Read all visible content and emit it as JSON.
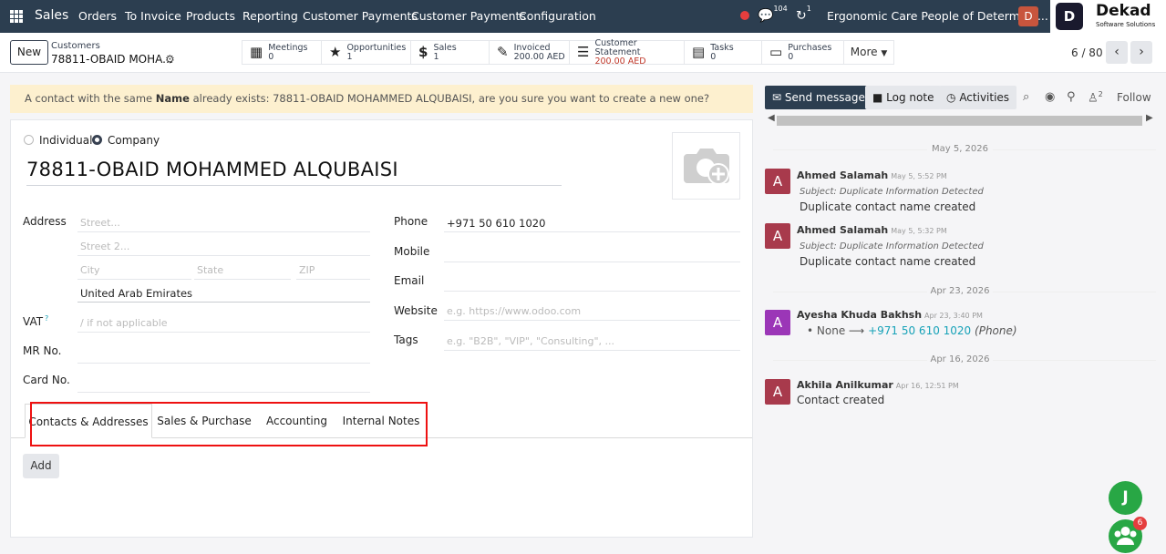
{
  "topbar": {
    "app_name": "Sales",
    "menu": [
      "Orders",
      "To Invoice",
      "Products",
      "Reporting",
      "Customer Payments",
      "Customer Payments",
      "Configuration"
    ],
    "messages_count": "104",
    "activities_count": "1",
    "company": "Ergonomic Care People of Determina...",
    "user_initial": "D",
    "brand_name": "Dekad",
    "brand_sub": "Software Solutions",
    "brand_logo": "D"
  },
  "control_panel": {
    "new_label": "New",
    "breadcrumb_parent": "Customers",
    "breadcrumb_current": "78811-OBAID MOHA...",
    "smart_buttons": [
      {
        "icon": "calendar-icon",
        "label": "Meetings",
        "value": "0"
      },
      {
        "icon": "star-icon",
        "label": "Opportunities",
        "value": "1"
      },
      {
        "icon": "dollar-icon",
        "label": "Sales",
        "value": "1"
      },
      {
        "icon": "invoice-icon",
        "label": "Invoiced",
        "value": "200.00 AED"
      },
      {
        "icon": "list-icon",
        "label": "Customer Statement",
        "value": "200.00 AED"
      },
      {
        "icon": "tasks-icon",
        "label": "Tasks",
        "value": "0"
      },
      {
        "icon": "credit-card-icon",
        "label": "Purchases",
        "value": "0"
      }
    ],
    "more_label": "More",
    "pager": "6 / 80"
  },
  "warning": {
    "prefix": "A contact with the same ",
    "bold": "Name",
    "suffix": " already exists: 78811-OBAID MOHAMMED ALQUBAISI, are you sure you want to create a new one?"
  },
  "form": {
    "type_individual": "Individual",
    "type_company": "Company",
    "name": "78811-OBAID MOHAMMED ALQUBAISI",
    "address_label": "Address",
    "street_ph": "Street...",
    "street2_ph": "Street 2...",
    "city_ph": "City",
    "state_ph": "State",
    "zip_ph": "ZIP",
    "country": "United Arab Emirates",
    "vat_label": "VAT",
    "vat_help": "?",
    "vat_ph": "/ if not applicable",
    "mr_label": "MR No.",
    "card_label": "Card No.",
    "phone_label": "Phone",
    "phone": "+971 50 610 1020",
    "mobile_label": "Mobile",
    "email_label": "Email",
    "website_label": "Website",
    "website_ph": "e.g. https://www.odoo.com",
    "tags_label": "Tags",
    "tags_ph": "e.g. \"B2B\", \"VIP\", \"Consulting\", ...",
    "tabs": [
      "Contacts & Addresses",
      "Sales & Purchase",
      "Accounting",
      "Internal Notes"
    ],
    "add_label": "Add"
  },
  "chatter": {
    "send_message": "Send message",
    "log_note": "Log note",
    "activities": "Activities",
    "followers_count": "2",
    "follow": "Follow",
    "messages": [
      {
        "date": "May 5, 2026"
      },
      {
        "author": "Ahmed Salamah",
        "time": "May 5, 5:52 PM",
        "subject": "Subject: Duplicate Information Detected",
        "body": "Duplicate contact name created",
        "avatar": "A",
        "color": "#a83a4c"
      },
      {
        "author": "Ahmed Salamah",
        "time": "May 5, 5:32 PM",
        "subject": "Subject: Duplicate Information Detected",
        "body": "Duplicate contact name created",
        "avatar": "A",
        "color": "#a83a4c"
      },
      {
        "date": "Apr 23, 2026"
      },
      {
        "author": "Ayesha Khuda Bakhsh",
        "time": "Apr 23, 3:40 PM",
        "old": "None",
        "new": "+971 50 610 1020",
        "field": "(Phone)",
        "avatar": "A",
        "color": "#9b36b7"
      },
      {
        "date": "Apr 16, 2026"
      },
      {
        "author": "Akhila Anilkumar",
        "time": "Apr 16, 12:51 PM",
        "body": "Contact created",
        "avatar": "A",
        "color": "#a83a4c"
      }
    ]
  },
  "floating": {
    "user_initial": "J",
    "badge": "6"
  },
  "colors": {
    "navbar": "#2c3e50",
    "warning_bg": "#fdf0cf",
    "highlight": "#e11111"
  }
}
